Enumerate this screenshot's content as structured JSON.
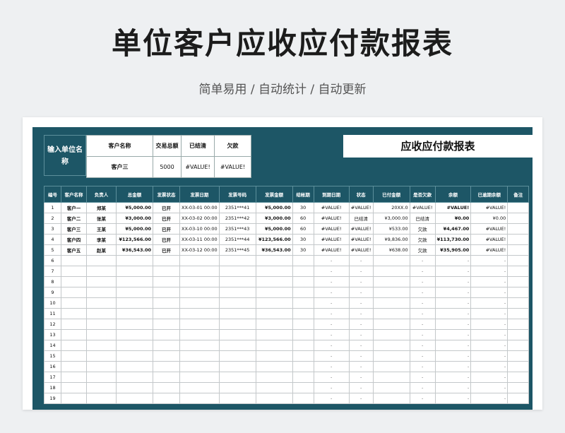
{
  "header": {
    "title": "单位客户应收应付款报表",
    "subtitle": "简单易用 / 自动统计 / 自动更新"
  },
  "input": {
    "label": "输入单位名称"
  },
  "info": {
    "headers": [
      "客户名称",
      "交易总额",
      "已结清",
      "欠款"
    ],
    "values": [
      "客户三",
      "5000",
      "#VALUE!",
      "#VALUE!"
    ]
  },
  "report_title": "应收应付款报表",
  "columns": [
    "编号",
    "客户名称",
    "负责人",
    "总金额",
    "发票状态",
    "发票日期",
    "发票号码",
    "发票金额",
    "结帐期",
    "到期日期",
    "状态",
    "已付金额",
    "是否欠款",
    "余额",
    "已逾期余额",
    "备注"
  ],
  "rows": [
    [
      "1",
      "客户一",
      "郑某",
      "¥5,000.00",
      "已开",
      "XX-03-01 00:00",
      "2351***41",
      "¥5,000.00",
      "30",
      "#VALUE!",
      "#VALUE!",
      "20XX.0",
      "#VALUE!",
      "#VALUE!",
      "#VALUE!",
      ""
    ],
    [
      "2",
      "客户二",
      "张某",
      "¥3,000.00",
      "已开",
      "XX-03-02 00:00",
      "2351***42",
      "¥3,000.00",
      "60",
      "#VALUE!",
      "已结清",
      "¥3,000.00",
      "已结清",
      "¥0.00",
      "¥0.00",
      ""
    ],
    [
      "3",
      "客户三",
      "王某",
      "¥5,000.00",
      "已开",
      "XX-03-10 00:00",
      "2351***43",
      "¥5,000.00",
      "60",
      "#VALUE!",
      "#VALUE!",
      "¥533.00",
      "欠款",
      "¥4,467.00",
      "#VALUE!",
      ""
    ],
    [
      "4",
      "客户四",
      "李某",
      "¥123,566.00",
      "已开",
      "XX-03-11 00:00",
      "2351***44",
      "¥123,566.00",
      "30",
      "#VALUE!",
      "#VALUE!",
      "¥9,836.00",
      "欠款",
      "¥113,730.00",
      "#VALUE!",
      ""
    ],
    [
      "5",
      "客户五",
      "赵某",
      "¥36,543.00",
      "已开",
      "XX-03-12 00:00",
      "2351***45",
      "¥36,543.00",
      "30",
      "#VALUE!",
      "#VALUE!",
      "¥638.00",
      "欠款",
      "¥35,905.00",
      "#VALUE!",
      ""
    ]
  ],
  "empty_rows": [
    "6",
    "7",
    "8",
    "9",
    "10",
    "11",
    "12",
    "13",
    "14",
    "15",
    "16",
    "17",
    "18",
    "19"
  ],
  "dash": "-"
}
